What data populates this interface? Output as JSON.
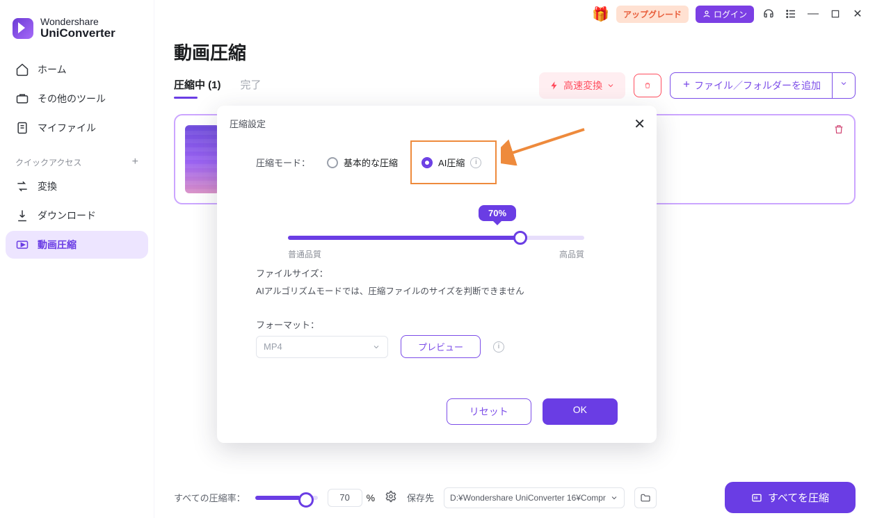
{
  "app": {
    "brand_top": "Wondershare",
    "brand_bottom": "UniConverter"
  },
  "titlebar": {
    "upgrade": "アップグレード",
    "login": "ログイン"
  },
  "sidebar": {
    "items": [
      {
        "label": "ホーム",
        "icon": "home"
      },
      {
        "label": "その他のツール",
        "icon": "tools"
      },
      {
        "label": "マイファイル",
        "icon": "files"
      }
    ],
    "quick_label": "クイックアクセス",
    "quick": [
      {
        "label": "変換",
        "icon": "convert"
      },
      {
        "label": "ダウンロード",
        "icon": "download"
      },
      {
        "label": "動画圧縮",
        "icon": "compress",
        "active": true
      }
    ]
  },
  "main": {
    "title": "動画圧縮",
    "tabs": [
      {
        "label": "圧縮中 (1)",
        "active": true
      },
      {
        "label": "完了"
      }
    ],
    "toolbar": {
      "fast_convert": "高速変換",
      "add_file": "ファイル／フォルダーを追加"
    }
  },
  "modal": {
    "title": "圧縮設定",
    "mode_label": "圧縮モード：",
    "mode_basic": "基本的な圧縮",
    "mode_ai": "AI圧縮",
    "slider_value": "70%",
    "slider_low": "普通品質",
    "slider_high": "高品質",
    "filesize_label": "ファイルサイズ：",
    "filesize_desc": "AIアルゴリズムモードでは、圧縮ファイルのサイズを判断できません",
    "format_label": "フォーマット：",
    "format_value": "MP4",
    "preview": "プレビュー",
    "reset": "リセット",
    "ok": "OK"
  },
  "bottombar": {
    "rate_label": "すべての圧縮率：",
    "rate_value": "70",
    "percent": "%",
    "save_to_label": "保存先",
    "path": "D:¥Wondershare UniConverter 16¥Compr",
    "compress_all": "すべてを圧縮"
  }
}
